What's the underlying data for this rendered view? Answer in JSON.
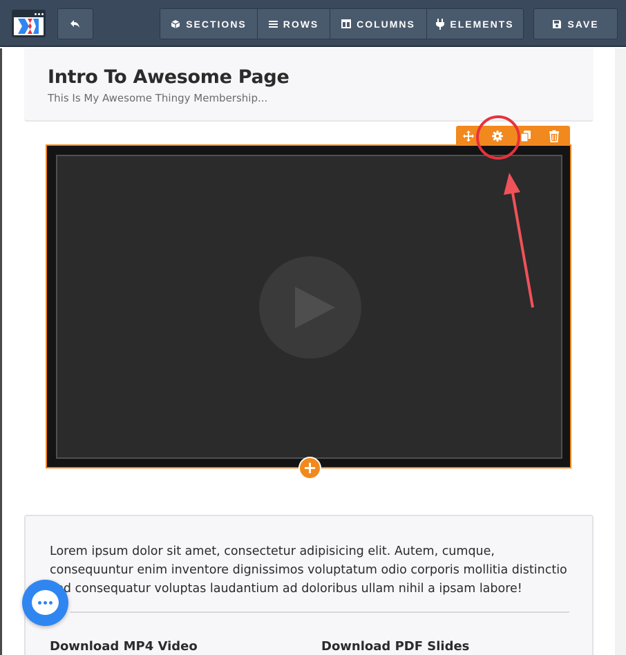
{
  "toolbar": {
    "undo_icon": "undo-arrow-icon",
    "sections_label": "SECTIONS",
    "rows_label": "ROWS",
    "columns_label": "COLUMNS",
    "elements_label": "ELEMENTS",
    "save_label": "SAVE"
  },
  "header": {
    "title": "Intro To Awesome Page",
    "subtitle": "This Is My Awesome Thingy Membership..."
  },
  "video_element": {
    "tools": [
      "move-icon",
      "gear-icon",
      "copy-icon",
      "trash-icon"
    ],
    "add_label": "+"
  },
  "content": {
    "lorem": "Lorem ipsum dolor sit amet, consectetur adipisicing elit. Autem, cumque, consequuntur enim inventore dignissimos voluptatum odio corporis mollitia distinctio sed consequatur voluptas laudantium ad doloribus ullam nihil a ipsam labore!",
    "download_mp4": "Download MP4 Video",
    "download_pdf": "Download PDF Slides"
  },
  "colors": {
    "toolbar_bg": "#3a4a5c",
    "accent_orange": "#f2891e",
    "annotation_red": "#e8313b",
    "chat_blue": "#2f86f0"
  }
}
